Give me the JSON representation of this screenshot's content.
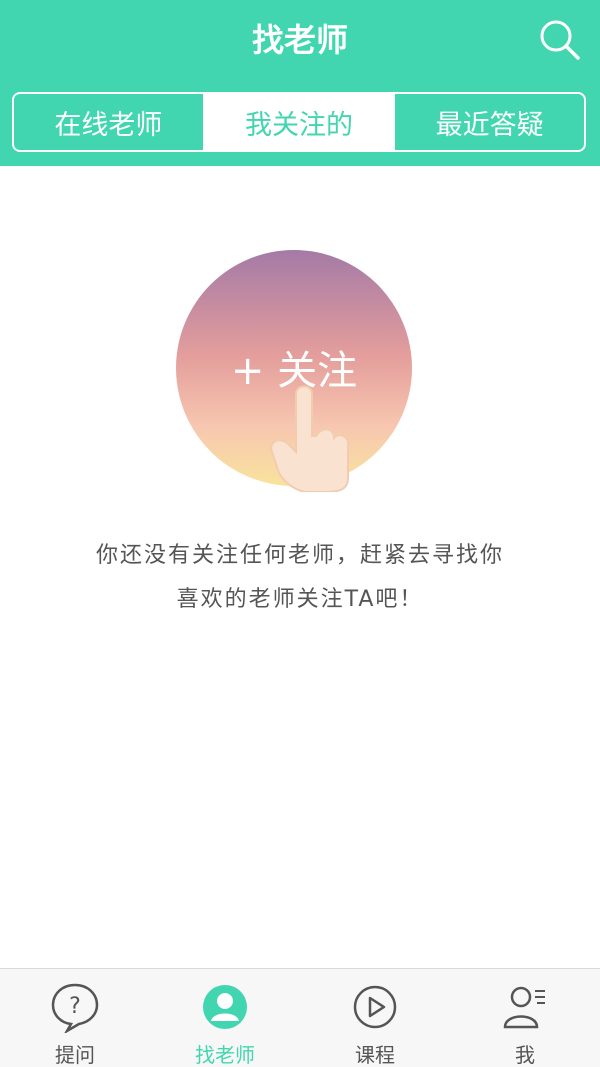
{
  "header": {
    "title": "找老师",
    "search_icon": "search-icon"
  },
  "tabs": [
    {
      "label": "在线老师",
      "active": false
    },
    {
      "label": "我关注的",
      "active": true
    },
    {
      "label": "最近答疑",
      "active": false
    }
  ],
  "empty_state": {
    "illustration_text": "+ 关注",
    "message_line1": "你还没有关注任何老师，赶紧去寻找你",
    "message_line2": "喜欢的老师关注TA吧！"
  },
  "bottom_nav": [
    {
      "label": "提问",
      "icon": "question-bubble-icon",
      "active": false
    },
    {
      "label": "找老师",
      "icon": "teacher-avatar-icon",
      "active": true
    },
    {
      "label": "课程",
      "icon": "play-circle-icon",
      "active": false
    },
    {
      "label": "我",
      "icon": "profile-icon",
      "active": false
    }
  ],
  "colors": {
    "accent": "#42d6b0",
    "text_muted": "#555555",
    "nav_bg": "#f7f7f7"
  }
}
